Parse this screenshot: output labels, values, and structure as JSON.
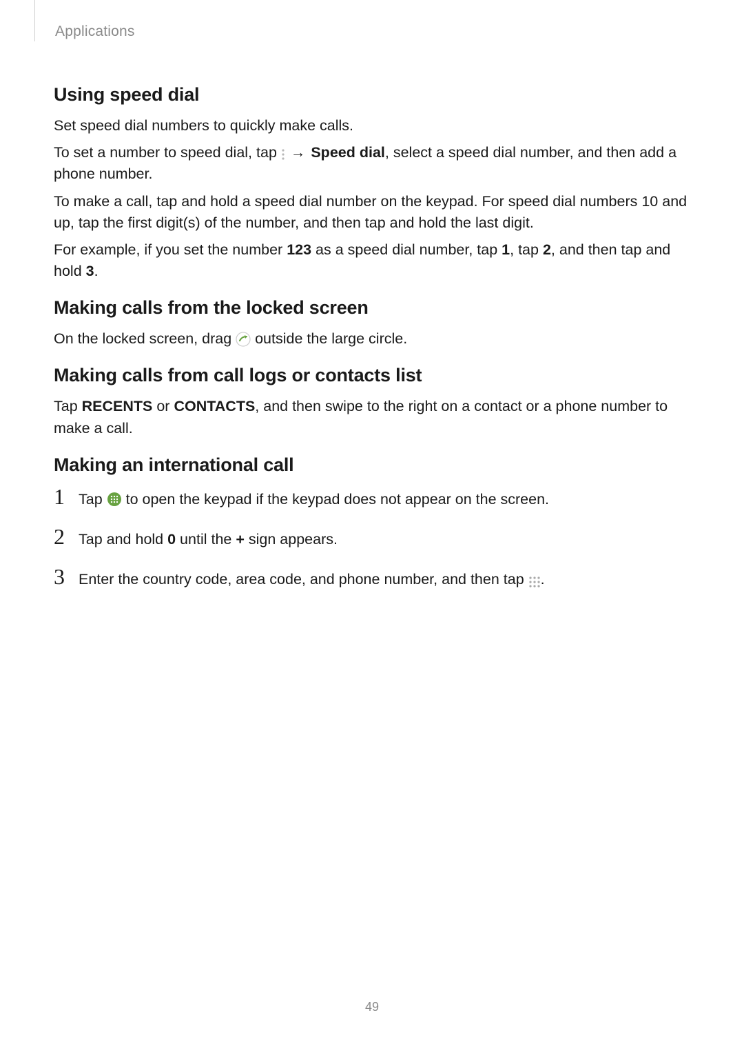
{
  "header": {
    "breadcrumb": "Applications"
  },
  "sections": {
    "speed_dial": {
      "title": "Using speed dial",
      "p1": "Set speed dial numbers to quickly make calls.",
      "p2_a": "To set a number to speed dial, tap ",
      "p2_arrow": "→",
      "p2_bold": "Speed dial",
      "p2_b": ", select a speed dial number, and then add a phone number.",
      "p3": "To make a call, tap and hold a speed dial number on the keypad. For speed dial numbers 10 and up, tap the first digit(s) of the number, and then tap and hold the last digit.",
      "p4_a": "For example, if you set the number ",
      "p4_b1": "123",
      "p4_b": " as a speed dial number, tap ",
      "p4_b2": "1",
      "p4_c": ", tap ",
      "p4_b3": "2",
      "p4_d": ", and then tap and hold ",
      "p4_b4": "3",
      "p4_e": "."
    },
    "locked": {
      "title": "Making calls from the locked screen",
      "p1_a": "On the locked screen, drag ",
      "p1_b": " outside the large circle."
    },
    "logs": {
      "title": "Making calls from call logs or contacts list",
      "p1_a": "Tap ",
      "p1_b1": "RECENTS",
      "p1_b": " or ",
      "p1_b2": "CONTACTS",
      "p1_c": ", and then swipe to the right on a contact or a phone number to make a call."
    },
    "intl": {
      "title": "Making an international call",
      "steps": {
        "s1_a": "Tap ",
        "s1_b": " to open the keypad if the keypad does not appear on the screen.",
        "s2_a": "Tap and hold ",
        "s2_b1": "0",
        "s2_b": " until the ",
        "s2_b2": "+",
        "s2_c": " sign appears.",
        "s3_a": "Enter the country code, area code, and phone number, and then tap ",
        "s3_b": "."
      },
      "nums": {
        "n1": "1",
        "n2": "2",
        "n3": "3"
      }
    }
  },
  "footer": {
    "page_number": "49"
  },
  "colors": {
    "accent_green": "#68a241",
    "icon_gray": "#a8a8a8"
  }
}
